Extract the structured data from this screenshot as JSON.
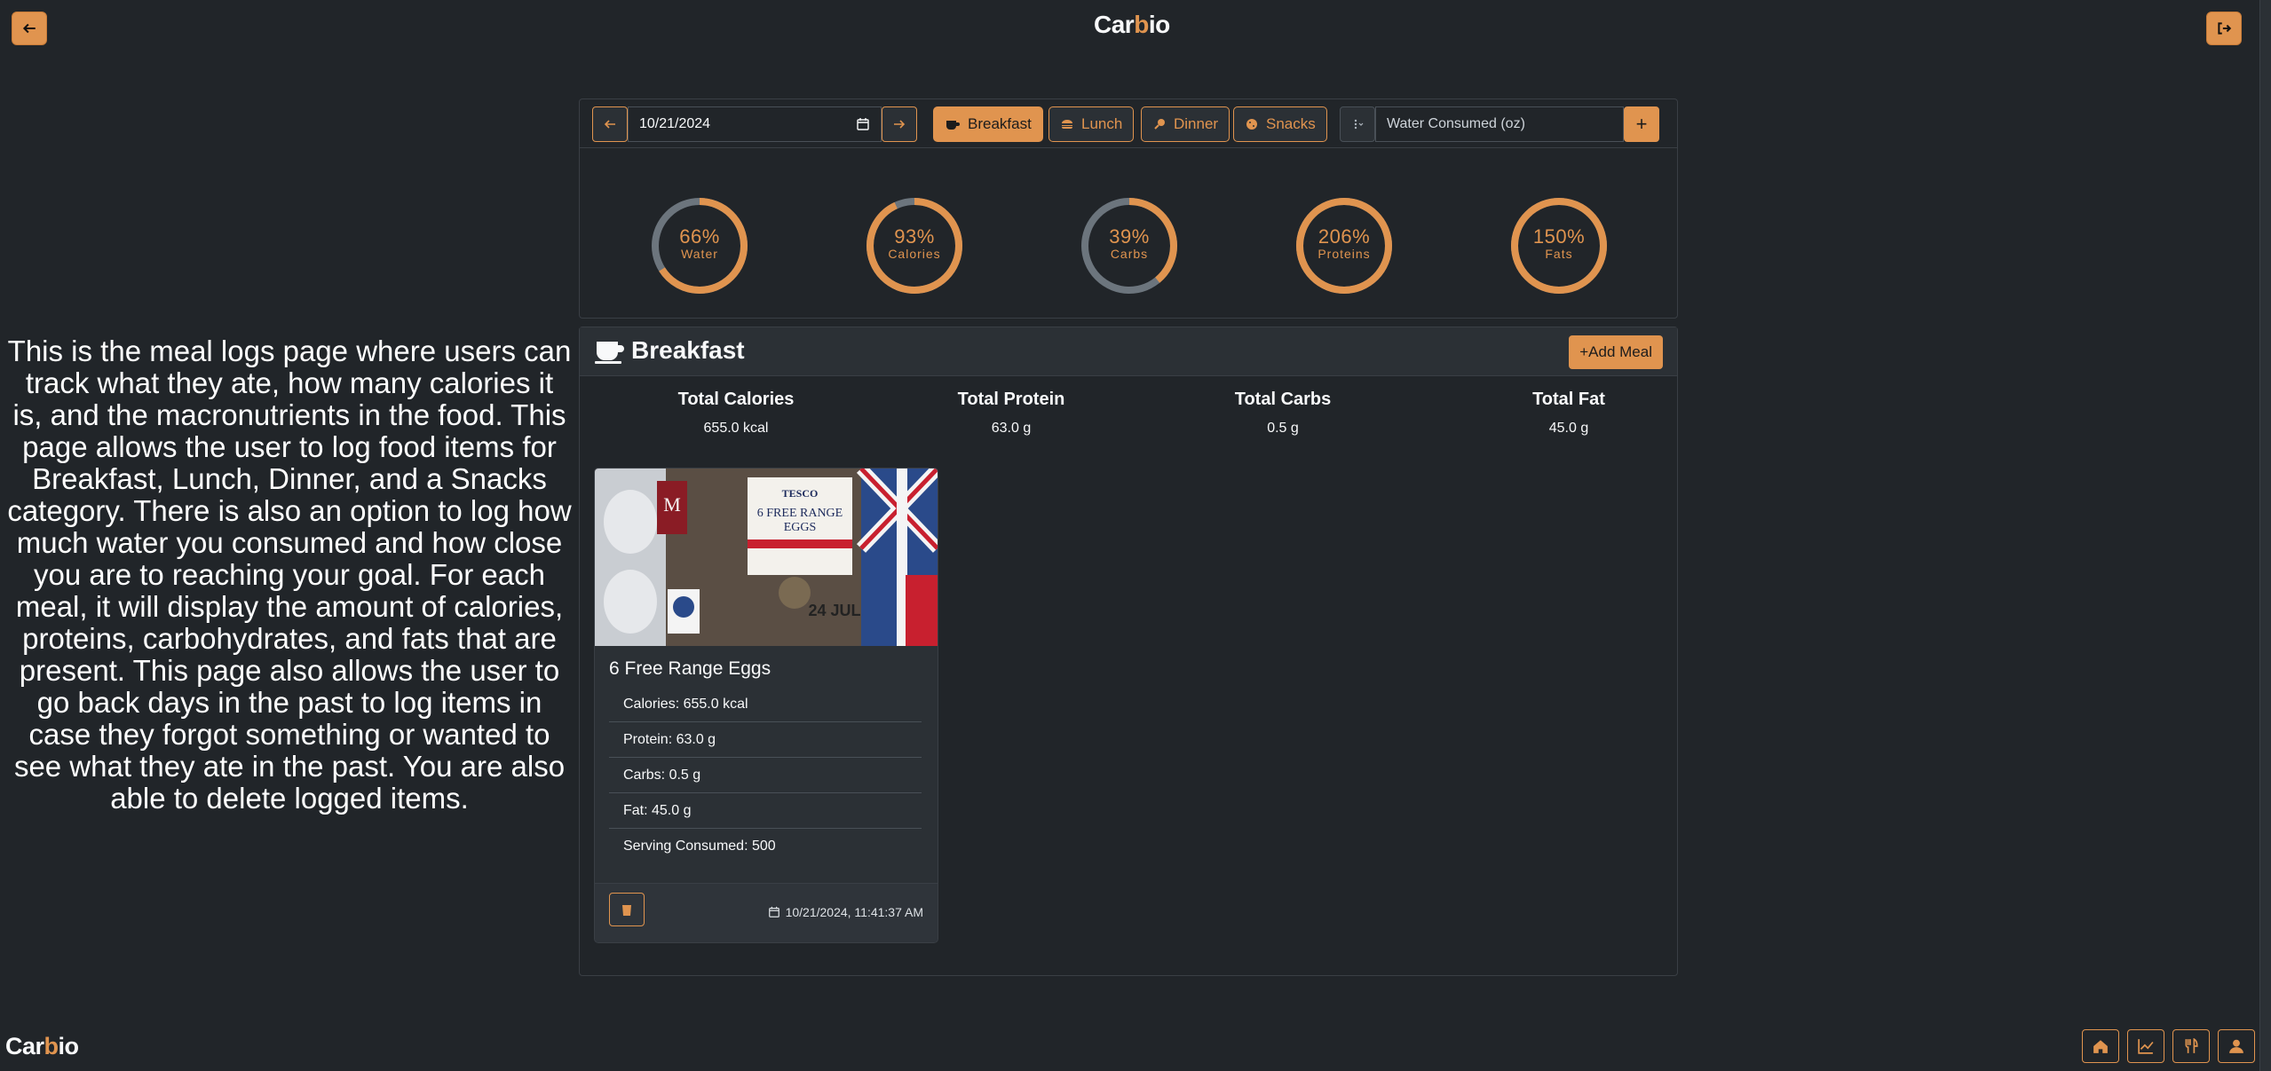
{
  "brand": {
    "prefix": "Car",
    "o": "b",
    "suffix": "io"
  },
  "description": "This is the meal logs page where users can track what they ate, how many calories it is, and the macronutrients in the food. This page allows the user to log food items for Breakfast, Lunch, Dinner, and a Snacks category. There is also an option to log how much water you consumed and how close you are to reaching your goal. For each meal, it will display the amount of calories, proteins, carbohydrates, and fats that are present. This page also allows the user to go back days in the past to log items in case they forgot something or wanted to see what they ate in the past. You are also able to delete logged items.",
  "toolbar": {
    "date": "10/21/2024",
    "tabs": [
      {
        "label": "Breakfast",
        "active": true,
        "icon": "coffee-icon"
      },
      {
        "label": "Lunch",
        "active": false,
        "icon": "burger-icon"
      },
      {
        "label": "Dinner",
        "active": false,
        "icon": "drumstick-icon"
      },
      {
        "label": "Snacks",
        "active": false,
        "icon": "cookie-icon"
      }
    ],
    "water_placeholder": "Water Consumed (oz)",
    "add_label": "+"
  },
  "rings": [
    {
      "pct_text": "66%",
      "label": "Water",
      "value": 66
    },
    {
      "pct_text": "93%",
      "label": "Calories",
      "value": 93
    },
    {
      "pct_text": "39%",
      "label": "Carbs",
      "value": 39
    },
    {
      "pct_text": "206%",
      "label": "Proteins",
      "value": 206
    },
    {
      "pct_text": "150%",
      "label": "Fats",
      "value": 150
    }
  ],
  "meal": {
    "title": "Breakfast",
    "add_button": "Add Meal",
    "totals": [
      {
        "label": "Total Calories",
        "value": "655.0 kcal"
      },
      {
        "label": "Total Protein",
        "value": "63.0 g"
      },
      {
        "label": "Total Carbs",
        "value": "0.5 g"
      },
      {
        "label": "Total Fat",
        "value": "45.0 g"
      }
    ],
    "item": {
      "name": "6 Free Range Eggs",
      "image_text": {
        "store": "TESCO",
        "product_l1": "6 FREE RANGE",
        "product_l2": "EGGS",
        "date": "24 JUL",
        "brand_mark": "M"
      },
      "rows": [
        "Calories: 655.0 kcal",
        "Protein: 63.0 g",
        "Carbs: 0.5 g",
        "Fat: 45.0 g",
        "Serving Consumed: 500"
      ],
      "timestamp": "10/21/2024, 11:41:37 AM"
    }
  },
  "colors": {
    "accent": "#e0944f",
    "background": "#212529",
    "panel": "#2b3035",
    "ring_track": "#6c757d"
  }
}
